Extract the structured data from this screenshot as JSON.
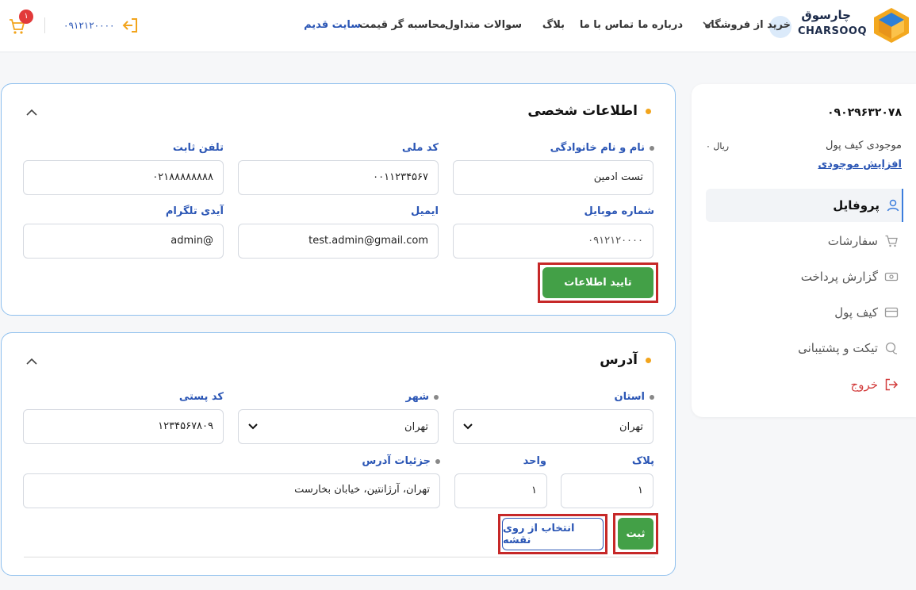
{
  "header": {
    "logo_fa": "چارسوق",
    "logo_en": "CHARSOOQ",
    "nav": {
      "shop": "خرید از فروشگاه",
      "about": "درباره ما",
      "contact": "تماس با ما",
      "blog": "بلاگ",
      "faq": "سوالات متداول",
      "price_calc": "محاسبه گر قیمت",
      "old_site": "سایت قدیم"
    },
    "phone": "۰۹۱۲۱۲۰۰۰۰",
    "cart_count": "۱"
  },
  "sidebar": {
    "phone": "۰۹۰۲۹۶۳۲۰۷۸",
    "wallet_label": "موجودی کیف پول",
    "wallet_value": "۰ ریال",
    "increase_balance": "افزایش موجودی",
    "items": [
      {
        "label": "پروفایل",
        "icon": "user-icon",
        "active": true
      },
      {
        "label": "سفارشات",
        "icon": "cart-icon"
      },
      {
        "label": "گزارش پرداخت",
        "icon": "cash-icon"
      },
      {
        "label": "کیف پول",
        "icon": "card-icon"
      },
      {
        "label": "تیکت و پشتیبانی",
        "icon": "chat-icon"
      },
      {
        "label": "خروج",
        "icon": "logout-icon"
      }
    ]
  },
  "personal": {
    "title": "اطلاعات شخصی",
    "fields": {
      "full_name": {
        "label": "نام و نام خانوادگی",
        "value": "تست ادمین"
      },
      "national_code": {
        "label": "کد ملی",
        "value": "۰۰۱۱۲۳۴۵۶۷"
      },
      "landline": {
        "label": "تلفن ثابت",
        "value": "۰۲۱۸۸۸۸۸۸۸۸"
      },
      "mobile": {
        "label": "شماره موبایل",
        "value": "۰۹۱۲۱۲۰۰۰۰"
      },
      "email": {
        "label": "ایمیل",
        "value": "test.admin@gmail.com"
      },
      "telegram": {
        "label": "آیدی تلگرام",
        "value": "admin@"
      }
    },
    "confirm_button": "تایید اطلاعات"
  },
  "address": {
    "title": "آدرس",
    "fields": {
      "province": {
        "label": "استان",
        "value": "تهران"
      },
      "city": {
        "label": "شهر",
        "value": "تهران"
      },
      "postal_code": {
        "label": "کد پستی",
        "value": "۱۲۳۴۵۶۷۸۰۹"
      },
      "plaque": {
        "label": "پلاک",
        "value": "۱"
      },
      "unit": {
        "label": "واحد",
        "value": "۱"
      },
      "details": {
        "label": "جزئیات آدرس",
        "value": "تهران، آرژانتین، خیابان بخارست"
      }
    },
    "submit_button": "ثبت",
    "map_button": "انتخاب از روی نقشه"
  },
  "colors": {
    "accent": "#2b56b5",
    "green": "#43a047",
    "highlight": "#c62828",
    "card_border": "#8fc0ee"
  }
}
